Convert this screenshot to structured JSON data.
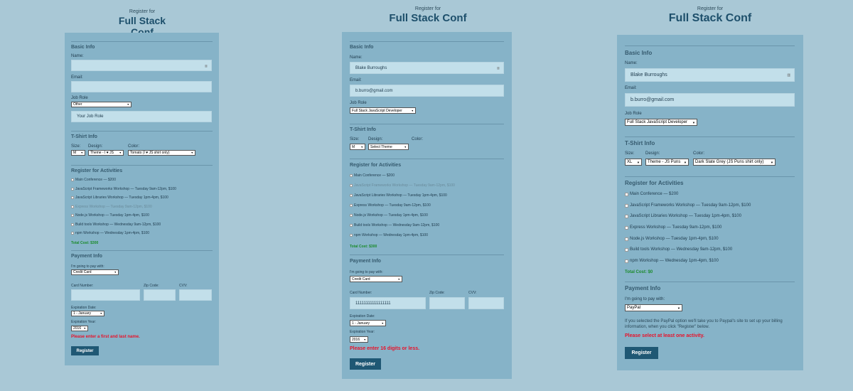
{
  "site": {
    "subtitle": "Register for",
    "title": "Full Stack Conf"
  },
  "labels": {
    "basic_info": "Basic Info",
    "name": "Name:",
    "email": "Email:",
    "job_role": "Job Role",
    "tshirt_info": "T-Shirt Info",
    "size": "Size:",
    "design": "Design:",
    "color": "Color:",
    "register_activities": "Register for Activities",
    "payment_info": "Payment Info",
    "pay_with": "I'm going to pay with:",
    "card_number": "Card Number:",
    "zip_code": "Zip Code:",
    "cvv": "CVV:",
    "expiration_date": "Expiration Date:",
    "expiration_year": "Expiration Year:",
    "register_button": "Register",
    "other_placeholder": "Your Job Role",
    "paypal_note": "If you selected the PayPal option we'll take you to Paypal's site to set up your billing information, when you click \"Register\" below."
  },
  "activities": [
    "Main Conference — $200",
    "JavaScript Frameworks Workshop — Tuesday 9am-12pm, $100",
    "JavaScript Libraries Workshop — Tuesday 1pm-4pm, $100",
    "Express Workshop — Tuesday 9am-12pm, $100",
    "Node.js Workshop — Tuesday 1pm-4pm, $100",
    "Build tools Workshop — Wednesday 9am-12pm, $100",
    "npm Workshop — Wednesday 1pm-4pm, $100"
  ],
  "form1": {
    "name": "",
    "email": "",
    "job_role": "Other",
    "size": "M",
    "design": "Theme - I ♥ JS",
    "color": "Tomato (I ♥ JS shirt only)",
    "total": "Total Cost: $300",
    "payment": "Credit Card",
    "card_number": "",
    "exp_month": "1 - January",
    "exp_year": "2016",
    "error": "Please enter a first and last name."
  },
  "form2": {
    "name": "Blake Burroughs",
    "email": "b.burro@gmail.com",
    "job_role": "Full Stack JavaScript Developer",
    "size": "M",
    "design": "Select Theme",
    "total": "Total Cost: $300",
    "payment": "Credit Card",
    "card_number": "11111111111111111",
    "exp_month": "1 - January",
    "exp_year": "2016",
    "error": "Please enter 16 digits or less."
  },
  "form3": {
    "name": "Blake Burroughs",
    "email": "b.burro@gmail.com",
    "job_role": "Full Stack JavaScript Developer",
    "size": "XL",
    "design": "Theme - JS Puns",
    "color": "Dark Slate Grey (JS Puns shirt only)",
    "total": "Total Cost: $0",
    "payment": "PayPal",
    "error": "Please select at least one activity."
  }
}
